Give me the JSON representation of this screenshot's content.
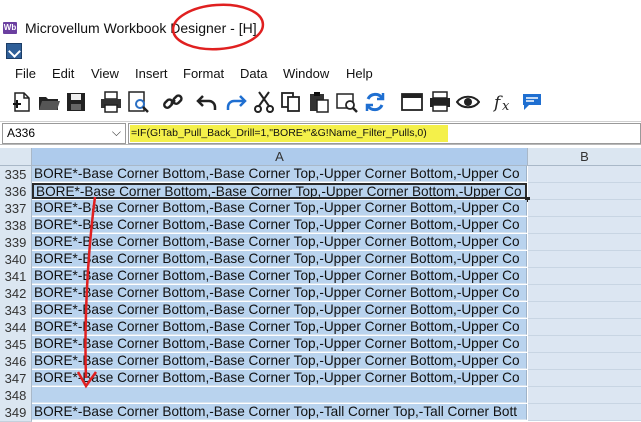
{
  "window": {
    "title": "Microvellum Workbook Designer - [H]",
    "app_icon": "Wb"
  },
  "menu": [
    "File",
    "Edit",
    "View",
    "Insert",
    "Format",
    "Data",
    "Window",
    "Help"
  ],
  "toolbar": {
    "buttons": [
      "new-sheet",
      "open-folder",
      "save",
      "print",
      "print-preview",
      "link",
      "undo",
      "redo",
      "cut",
      "copy",
      "paste",
      "find",
      "refresh",
      "window",
      "printer",
      "view",
      "function",
      "comment"
    ]
  },
  "formula_bar": {
    "name_box": "A336",
    "formula": "=IF(G!Tab_Pull_Back_Drill=1,\"BORE*\"&G!Name_Filter_Pulls,0)"
  },
  "grid": {
    "columns": [
      "A",
      "B"
    ],
    "rows": [
      {
        "num": "335",
        "a": "BORE*-Base Corner Bottom,-Base Corner Top,-Upper Corner Bottom,-Upper Co"
      },
      {
        "num": "336",
        "a": "BORE*-Base Corner Bottom,-Base Corner Top,-Upper Corner Bottom,-Upper Co"
      },
      {
        "num": "337",
        "a": "BORE*-Base Corner Bottom,-Base Corner Top,-Upper Corner Bottom,-Upper Co"
      },
      {
        "num": "338",
        "a": "BORE*-Base Corner Bottom,-Base Corner Top,-Upper Corner Bottom,-Upper Co"
      },
      {
        "num": "339",
        "a": "BORE*-Base Corner Bottom,-Base Corner Top,-Upper Corner Bottom,-Upper Co"
      },
      {
        "num": "340",
        "a": "BORE*-Base Corner Bottom,-Base Corner Top,-Upper Corner Bottom,-Upper Co"
      },
      {
        "num": "341",
        "a": "BORE*-Base Corner Bottom,-Base Corner Top,-Upper Corner Bottom,-Upper Co"
      },
      {
        "num": "342",
        "a": "BORE*-Base Corner Bottom,-Base Corner Top,-Upper Corner Bottom,-Upper Co"
      },
      {
        "num": "343",
        "a": "BORE*-Base Corner Bottom,-Base Corner Top,-Upper Corner Bottom,-Upper Co"
      },
      {
        "num": "344",
        "a": "BORE*-Base Corner Bottom,-Base Corner Top,-Upper Corner Bottom,-Upper Co"
      },
      {
        "num": "345",
        "a": "BORE*-Base Corner Bottom,-Base Corner Top,-Upper Corner Bottom,-Upper Co"
      },
      {
        "num": "346",
        "a": "BORE*-Base Corner Bottom,-Base Corner Top,-Upper Corner Bottom,-Upper Co"
      },
      {
        "num": "347",
        "a": "BORE*-Base Corner Bottom,-Base Corner Top,-Upper Corner Bottom,-Upper Co"
      },
      {
        "num": "348",
        "a": ""
      },
      {
        "num": "349",
        "a": "BORE*-Base Corner Bottom,-Base Corner Top,-Tall Corner Top,-Tall Corner Bott"
      }
    ]
  },
  "colors": {
    "annotation": "#e02020",
    "highlight": "#f4f04a",
    "selection": "#b9d3ee"
  }
}
